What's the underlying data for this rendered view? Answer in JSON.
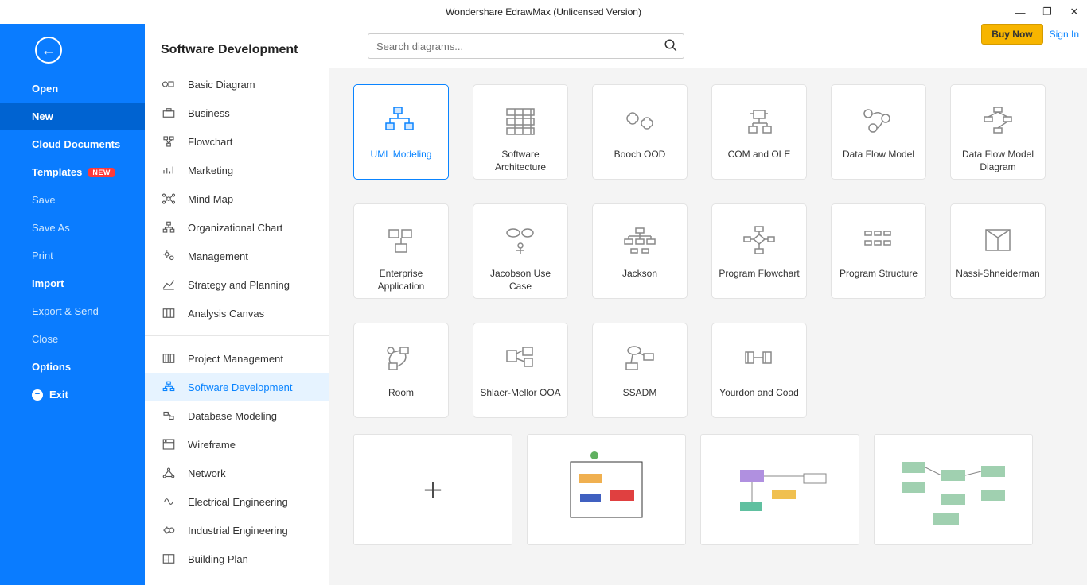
{
  "window": {
    "title": "Wondershare EdrawMax (Unlicensed Version)",
    "buy_label": "Buy Now",
    "signin_label": "Sign In"
  },
  "sidebar": {
    "items": [
      {
        "label": "Open",
        "style": "bold"
      },
      {
        "label": "New",
        "style": "active"
      },
      {
        "label": "Cloud Documents",
        "style": "bold"
      },
      {
        "label": "Templates",
        "style": "bold",
        "badge": "NEW"
      },
      {
        "label": "Save",
        "style": "dim"
      },
      {
        "label": "Save As",
        "style": "dim"
      },
      {
        "label": "Print",
        "style": "dim"
      },
      {
        "label": "Import",
        "style": "bold"
      },
      {
        "label": "Export & Send",
        "style": "dim"
      },
      {
        "label": "Close",
        "style": "dim"
      },
      {
        "label": "Options",
        "style": "bold"
      },
      {
        "label": "Exit",
        "style": "bold",
        "icon": "exit"
      }
    ]
  },
  "categories": {
    "header": "Software Development",
    "group1": [
      {
        "label": "Basic Diagram",
        "icon": "basic"
      },
      {
        "label": "Business",
        "icon": "business"
      },
      {
        "label": "Flowchart",
        "icon": "flowchart"
      },
      {
        "label": "Marketing",
        "icon": "marketing"
      },
      {
        "label": "Mind Map",
        "icon": "mindmap"
      },
      {
        "label": "Organizational Chart",
        "icon": "orgchart"
      },
      {
        "label": "Management",
        "icon": "management"
      },
      {
        "label": "Strategy and Planning",
        "icon": "strategy"
      },
      {
        "label": "Analysis Canvas",
        "icon": "canvas"
      }
    ],
    "group2": [
      {
        "label": "Project Management",
        "icon": "project"
      },
      {
        "label": "Software Development",
        "icon": "software",
        "selected": true
      },
      {
        "label": "Database Modeling",
        "icon": "database"
      },
      {
        "label": "Wireframe",
        "icon": "wireframe"
      },
      {
        "label": "Network",
        "icon": "network"
      },
      {
        "label": "Electrical Engineering",
        "icon": "electrical"
      },
      {
        "label": "Industrial Engineering",
        "icon": "industrial"
      },
      {
        "label": "Building Plan",
        "icon": "building"
      }
    ]
  },
  "search": {
    "placeholder": "Search diagrams..."
  },
  "templates": [
    {
      "label": "UML Modeling",
      "icon": "uml",
      "selected": true
    },
    {
      "label": "Software Architecture",
      "icon": "arch"
    },
    {
      "label": "Booch OOD",
      "icon": "booch"
    },
    {
      "label": "COM and OLE",
      "icon": "com"
    },
    {
      "label": "Data Flow Model",
      "icon": "dfm"
    },
    {
      "label": "Data Flow Model Diagram",
      "icon": "dfmd"
    },
    {
      "label": "Enterprise Application",
      "icon": "enterprise"
    },
    {
      "label": "Jacobson Use Case",
      "icon": "jacobson"
    },
    {
      "label": "Jackson",
      "icon": "jackson"
    },
    {
      "label": "Program Flowchart",
      "icon": "pflow"
    },
    {
      "label": "Program Structure",
      "icon": "pstruct"
    },
    {
      "label": "Nassi-Shneiderman",
      "icon": "nassi"
    },
    {
      "label": "Room",
      "icon": "room"
    },
    {
      "label": "Shlaer-Mellor OOA",
      "icon": "shlaer"
    },
    {
      "label": "SSADM",
      "icon": "ssadm"
    },
    {
      "label": "Yourdon and Coad",
      "icon": "yourdon"
    }
  ]
}
